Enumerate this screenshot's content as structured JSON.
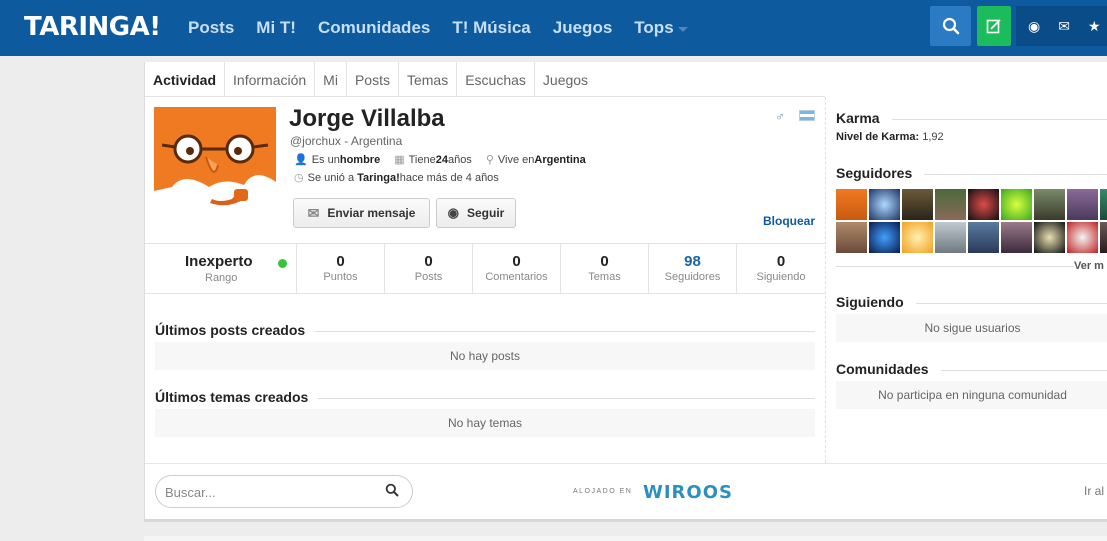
{
  "header": {
    "logo": "TARINGA!",
    "nav": [
      "Posts",
      "Mi T!",
      "Comunidades",
      "T! Música",
      "Juegos"
    ],
    "tops_label": "Tops"
  },
  "tabs": [
    "Actividad",
    "Información",
    "Mi",
    "Posts",
    "Temas",
    "Escuchas",
    "Juegos"
  ],
  "profile": {
    "name": "Jorge Villalba",
    "handle": "@jorchux - Argentina",
    "gender_prefix": "Es un ",
    "gender": "hombre",
    "age_prefix": "Tiene ",
    "age": "24",
    "age_suffix": " años",
    "lives_prefix": "Vive en ",
    "lives": "Argentina",
    "joined_prefix": "Se unió a ",
    "joined_site": "Taringa!",
    "joined_suffix": " hace más de 4 años",
    "message_button": "Enviar mensaje",
    "follow_button": "Seguir",
    "block_link": "Bloquear"
  },
  "stats": {
    "rank_value": "Inexperto",
    "rank_label": "Rango",
    "items": [
      {
        "value": "0",
        "label": "Puntos"
      },
      {
        "value": "0",
        "label": "Posts"
      },
      {
        "value": "0",
        "label": "Comentarios"
      },
      {
        "value": "0",
        "label": "Temas"
      },
      {
        "value": "98",
        "label": "Seguidores"
      },
      {
        "value": "0",
        "label": "Siguiendo"
      }
    ]
  },
  "sections": {
    "posts_title": "Últimos posts creados",
    "posts_empty": "No hay posts",
    "topics_title": "Últimos temas creados",
    "topics_empty": "No hay temas"
  },
  "sidebar": {
    "karma_title": "Karma",
    "karma_label": "Nivel de Karma:",
    "karma_value": "1,92",
    "followers_title": "Seguidores",
    "see_more": "Ver m",
    "following_title": "Siguiendo",
    "following_empty": "No sigue usuarios",
    "communities_title": "Comunidades",
    "communities_empty": "No participa en ninguna comunidad"
  },
  "footer": {
    "search_placeholder": "Buscar...",
    "hosted_by": "ALOJADO EN",
    "hosting_brand": "WIROOS",
    "goto": "Ir al"
  },
  "colors": {
    "topbar": "#0e5a9e",
    "search_button": "#2b7bc4",
    "new_button": "#1cbc5c",
    "link": "#0e5a9e",
    "online": "#3ac23a",
    "avatar_orange": "#f07a22"
  }
}
